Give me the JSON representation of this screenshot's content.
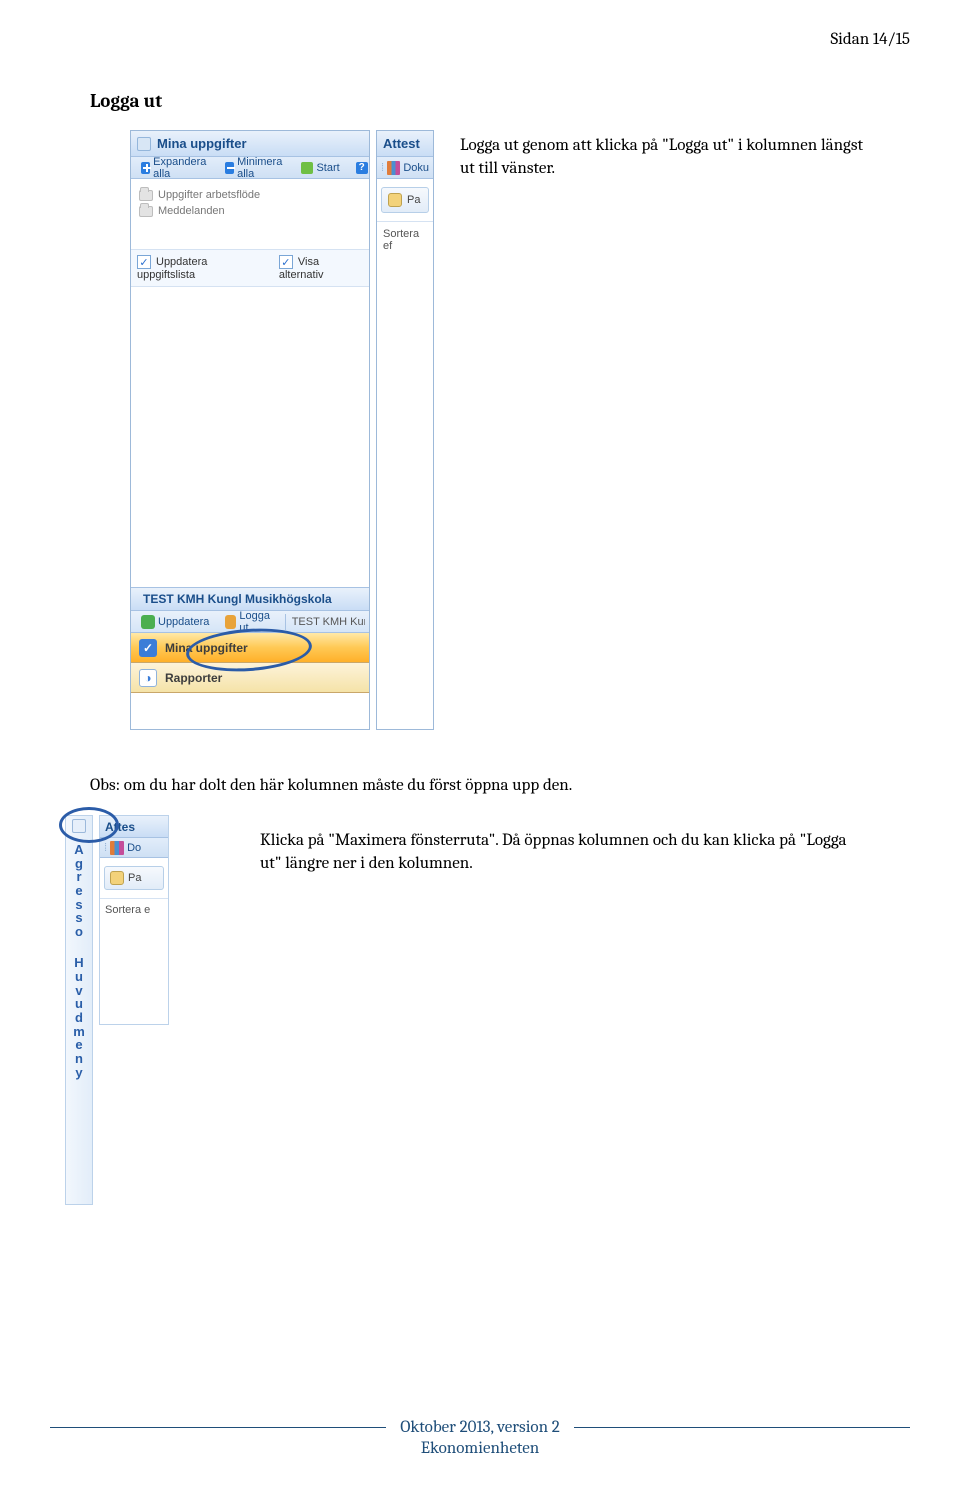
{
  "page_number": "Sidan 14/15",
  "section_title": "Logga ut",
  "para1": "Logga ut genom att klicka på \"Logga ut\" i kolumnen längst ut till vänster.",
  "para_obs": "Obs: om du har dolt den här kolumnen måste du först öppna upp den.",
  "para2": "Klicka på \"Maximera fönsterruta\". Då öppnas kolumnen och du kan klicka på \"Logga ut\" längre ner i den kolumnen.",
  "footer": {
    "line1": "Oktober 2013, version 2",
    "line2": "Ekonomienheten"
  },
  "ss1": {
    "panel_title": "Mina uppgifter",
    "toolbar": {
      "expand": "Expandera alla",
      "minimize": "Minimera alla",
      "start": "Start",
      "help": "?"
    },
    "tree": {
      "item1": "Uppgifter arbetsflöde",
      "item2": "Meddelanden"
    },
    "opts": {
      "update": "Uppdatera uppgiftslista",
      "showalt": "Visa alternativ"
    },
    "bottom_title": "TEST KMH Kungl Musikhögskola",
    "bottom_bar": {
      "refresh": "Uppdatera",
      "logout": "Logga ut",
      "context": "TEST KMH Kungl M"
    },
    "nav": {
      "active": "Mina uppgifter",
      "reports": "Rapporter"
    },
    "right": {
      "title": "Attest",
      "tb": "Doku",
      "btn": "Pa",
      "sort": "Sortera ef"
    }
  },
  "ss2": {
    "vertical_top": "Agresso",
    "vertical_bottom": "Huvudmeny",
    "right": {
      "title": "Attes",
      "tb": "Do",
      "btn": "Pa",
      "sort": "Sortera e"
    }
  }
}
